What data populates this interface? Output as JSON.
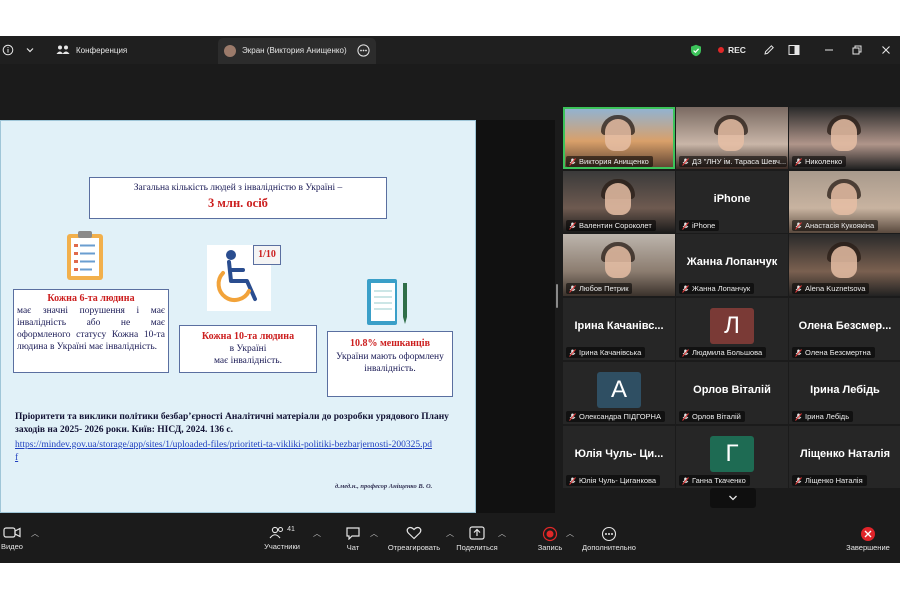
{
  "topbar": {
    "info_icon": "info-icon",
    "conference_label": "Конференция",
    "screen_tab_label": "Экран (Виктория Анищенко)",
    "rec_label": "REC",
    "colors": {
      "shield": "#3cc35a",
      "rec": "#e02828"
    }
  },
  "slide": {
    "title_line": "Загальна кількість людей з інвалідністю в Україні –",
    "title_highlight": "3 млн. осіб",
    "box1_heading": "Кожна 6-та людина",
    "box1_text": "має значні порушення і має інвалідність або не має оформленого статусу Кожна 10-та людина в Україні має інвалідність.",
    "badge": "1/10",
    "box2_heading": "Кожна 10-та людина",
    "box2_line1": "в Україні",
    "box2_line2": "має інвалідність.",
    "box3_heading": "10.8% мешканців",
    "box3_text": "України мають оформлену інвалідність.",
    "source_text": "Пріоритети та виклики політики безбар’єрності Аналітичні матеріали до розробки урядового Плану заходів на 2025- 2026 роки. Київ: НІСД, 2024. 136 с.",
    "source_link": "https://mindev.gov.ua/storage/app/sites/1/uploaded-files/prioriteti-ta-vikliki-politiki-bezbarjernosti-200325.pdf",
    "author": "д.мед.н., професор Аніщенко В. О.",
    "colors": {
      "background": "#e1f1f8",
      "accent_red": "#cc1f1f"
    }
  },
  "participants": [
    {
      "label": "Виктория Анищенко",
      "type": "video",
      "active": true
    },
    {
      "label": "ДЗ \"ЛНУ ім. Тараса Шевч...",
      "type": "video"
    },
    {
      "label": "Николенко",
      "type": "video"
    },
    {
      "label": "Валентин Сороколет",
      "type": "video"
    },
    {
      "label": "iPhone",
      "type": "name",
      "display": "iPhone"
    },
    {
      "label": "Анастасія Кукоякіна",
      "type": "video"
    },
    {
      "label": "Любов Петрик",
      "type": "video"
    },
    {
      "label": "Жанна Лопанчук",
      "type": "name",
      "display": "Жанна Лопанчук"
    },
    {
      "label": "Alena Kuznetsova",
      "type": "video"
    },
    {
      "label": "Ірина Качанівська",
      "type": "name",
      "display": "Ірина Качанівс..."
    },
    {
      "label": "Людмила Большова",
      "type": "avatar",
      "letter": "Л",
      "color": "#7a3a36"
    },
    {
      "label": "Олена Безсмертна",
      "type": "name",
      "display": "Олена Безсмер..."
    },
    {
      "label": "Олександра ПІДГОРНА",
      "type": "avatar",
      "letter": "А",
      "color": "#2f4f63"
    },
    {
      "label": "Орлов Віталій",
      "type": "name",
      "display": "Орлов Віталій"
    },
    {
      "label": "Ірина Лебідь",
      "type": "name",
      "display": "Ірина Лебідь"
    },
    {
      "label": "Юлія Чуль- Циганкова",
      "type": "name",
      "display": "Юлія Чуль- Ци..."
    },
    {
      "label": "Ганна Ткаченко",
      "type": "avatar",
      "letter": "Г",
      "color": "#1e6b53"
    },
    {
      "label": "Ліщенко Наталія",
      "type": "name",
      "display": "Ліщенко Наталія"
    }
  ],
  "toolbar": {
    "video_label": "Видео",
    "participants_label": "Участники",
    "participants_count": "41",
    "chat_label": "Чат",
    "react_label": "Отреагировать",
    "share_label": "Поделиться",
    "record_label": "Запись",
    "more_label": "Дополнительно",
    "end_label": "Завершение"
  }
}
